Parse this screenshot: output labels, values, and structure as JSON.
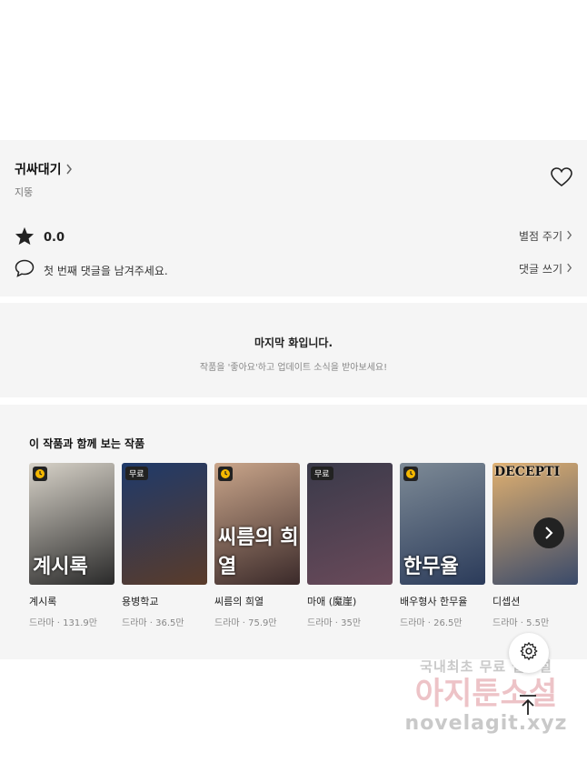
{
  "work": {
    "title": "귀싸대기",
    "author": "지뚱"
  },
  "rating": {
    "value": "0.0",
    "rate_link": "별점 주기"
  },
  "comment": {
    "prompt": "첫 번째 댓글을 남겨주세요.",
    "link": "댓글 쓰기"
  },
  "last_episode": {
    "title": "마지막 화입니다.",
    "subtitle": "작품을 '좋아요'하고 업데이트 소식을 받아보세요!"
  },
  "recommend": {
    "title": "이 작품과 함께 보는 작품",
    "free_label": "무료",
    "items": [
      {
        "name": "계시록",
        "meta": "드라마 · 131.9만",
        "badge": "clock",
        "caption": "계시록",
        "colors": [
          "#d7d2c8",
          "#2a2a2a"
        ]
      },
      {
        "name": "용병학교",
        "meta": "드라마 · 36.5만",
        "badge": "free",
        "caption": "",
        "colors": [
          "#1f3a6a",
          "#5a3b2a"
        ]
      },
      {
        "name": "씨름의 희열",
        "meta": "드라마 · 75.9만",
        "badge": "clock",
        "caption": "씨름의 희열",
        "colors": [
          "#c9a58a",
          "#3b2a2a"
        ]
      },
      {
        "name": "마애 (魔崖)",
        "meta": "드라마 · 35만",
        "badge": "free",
        "caption": "",
        "colors": [
          "#3a3a4a",
          "#6a4a5a"
        ]
      },
      {
        "name": "배우형사 한무율",
        "meta": "드라마 · 26.5만",
        "badge": "clock",
        "caption": "한무율",
        "colors": [
          "#7d8a96",
          "#2b3b5a"
        ]
      },
      {
        "name": "디셉션",
        "meta": "드라마 · 5.5만",
        "badge": "none",
        "caption": "DECEPTI",
        "colors": [
          "#e0b070",
          "#3a4a6a"
        ]
      }
    ]
  },
  "watermark": {
    "line1": "국내최초 무료 웹소설",
    "line2": "아지툰소설",
    "line3": "novelagit.xyz"
  },
  "icons": {
    "heart": "heart-icon",
    "star": "star-icon",
    "comment": "comment-icon",
    "chevron": "chevron-right-icon",
    "settings": "gear-icon",
    "scroll_top": "arrow-up-icon",
    "clock": "clock-icon"
  }
}
